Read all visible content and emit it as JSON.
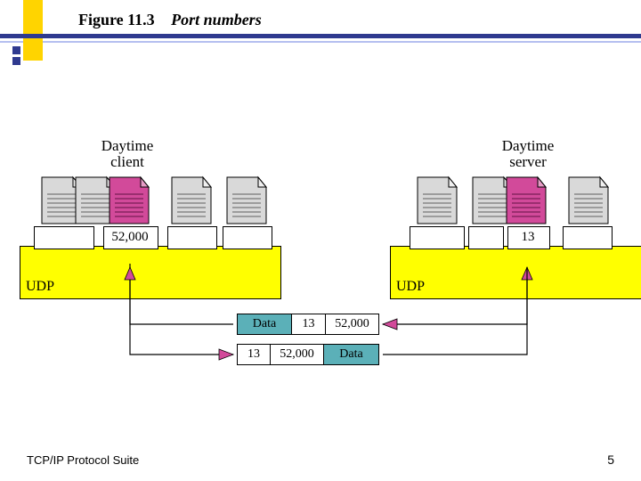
{
  "title": {
    "figure": "Figure 11.3",
    "caption": "Port numbers"
  },
  "footer": {
    "left": "TCP/IP Protocol Suite",
    "page": "5"
  },
  "left_host": {
    "label_line1": "Daytime",
    "label_line2": "client",
    "udp_label": "UDP",
    "port": "52,000"
  },
  "right_host": {
    "label_line1": "Daytime",
    "label_line2": "server",
    "udp_label": "UDP",
    "port": "13"
  },
  "packet_top": {
    "data": "Data",
    "a": "13",
    "b": "52,000"
  },
  "packet_bottom": {
    "a": "13",
    "b": "52,000",
    "data": "Data"
  },
  "chart_data": {
    "type": "diagram",
    "description": "Port numbers: client (ephemeral port) communicates with Daytime server (well-known port 13) over UDP",
    "client_port": 52000,
    "server_port": 13,
    "protocol": "UDP",
    "messages": [
      {
        "direction": "client_to_server",
        "dest_port": 13,
        "src_port": 52000
      },
      {
        "direction": "server_to_client",
        "dest_port": 13,
        "src_port": 52000
      }
    ]
  }
}
